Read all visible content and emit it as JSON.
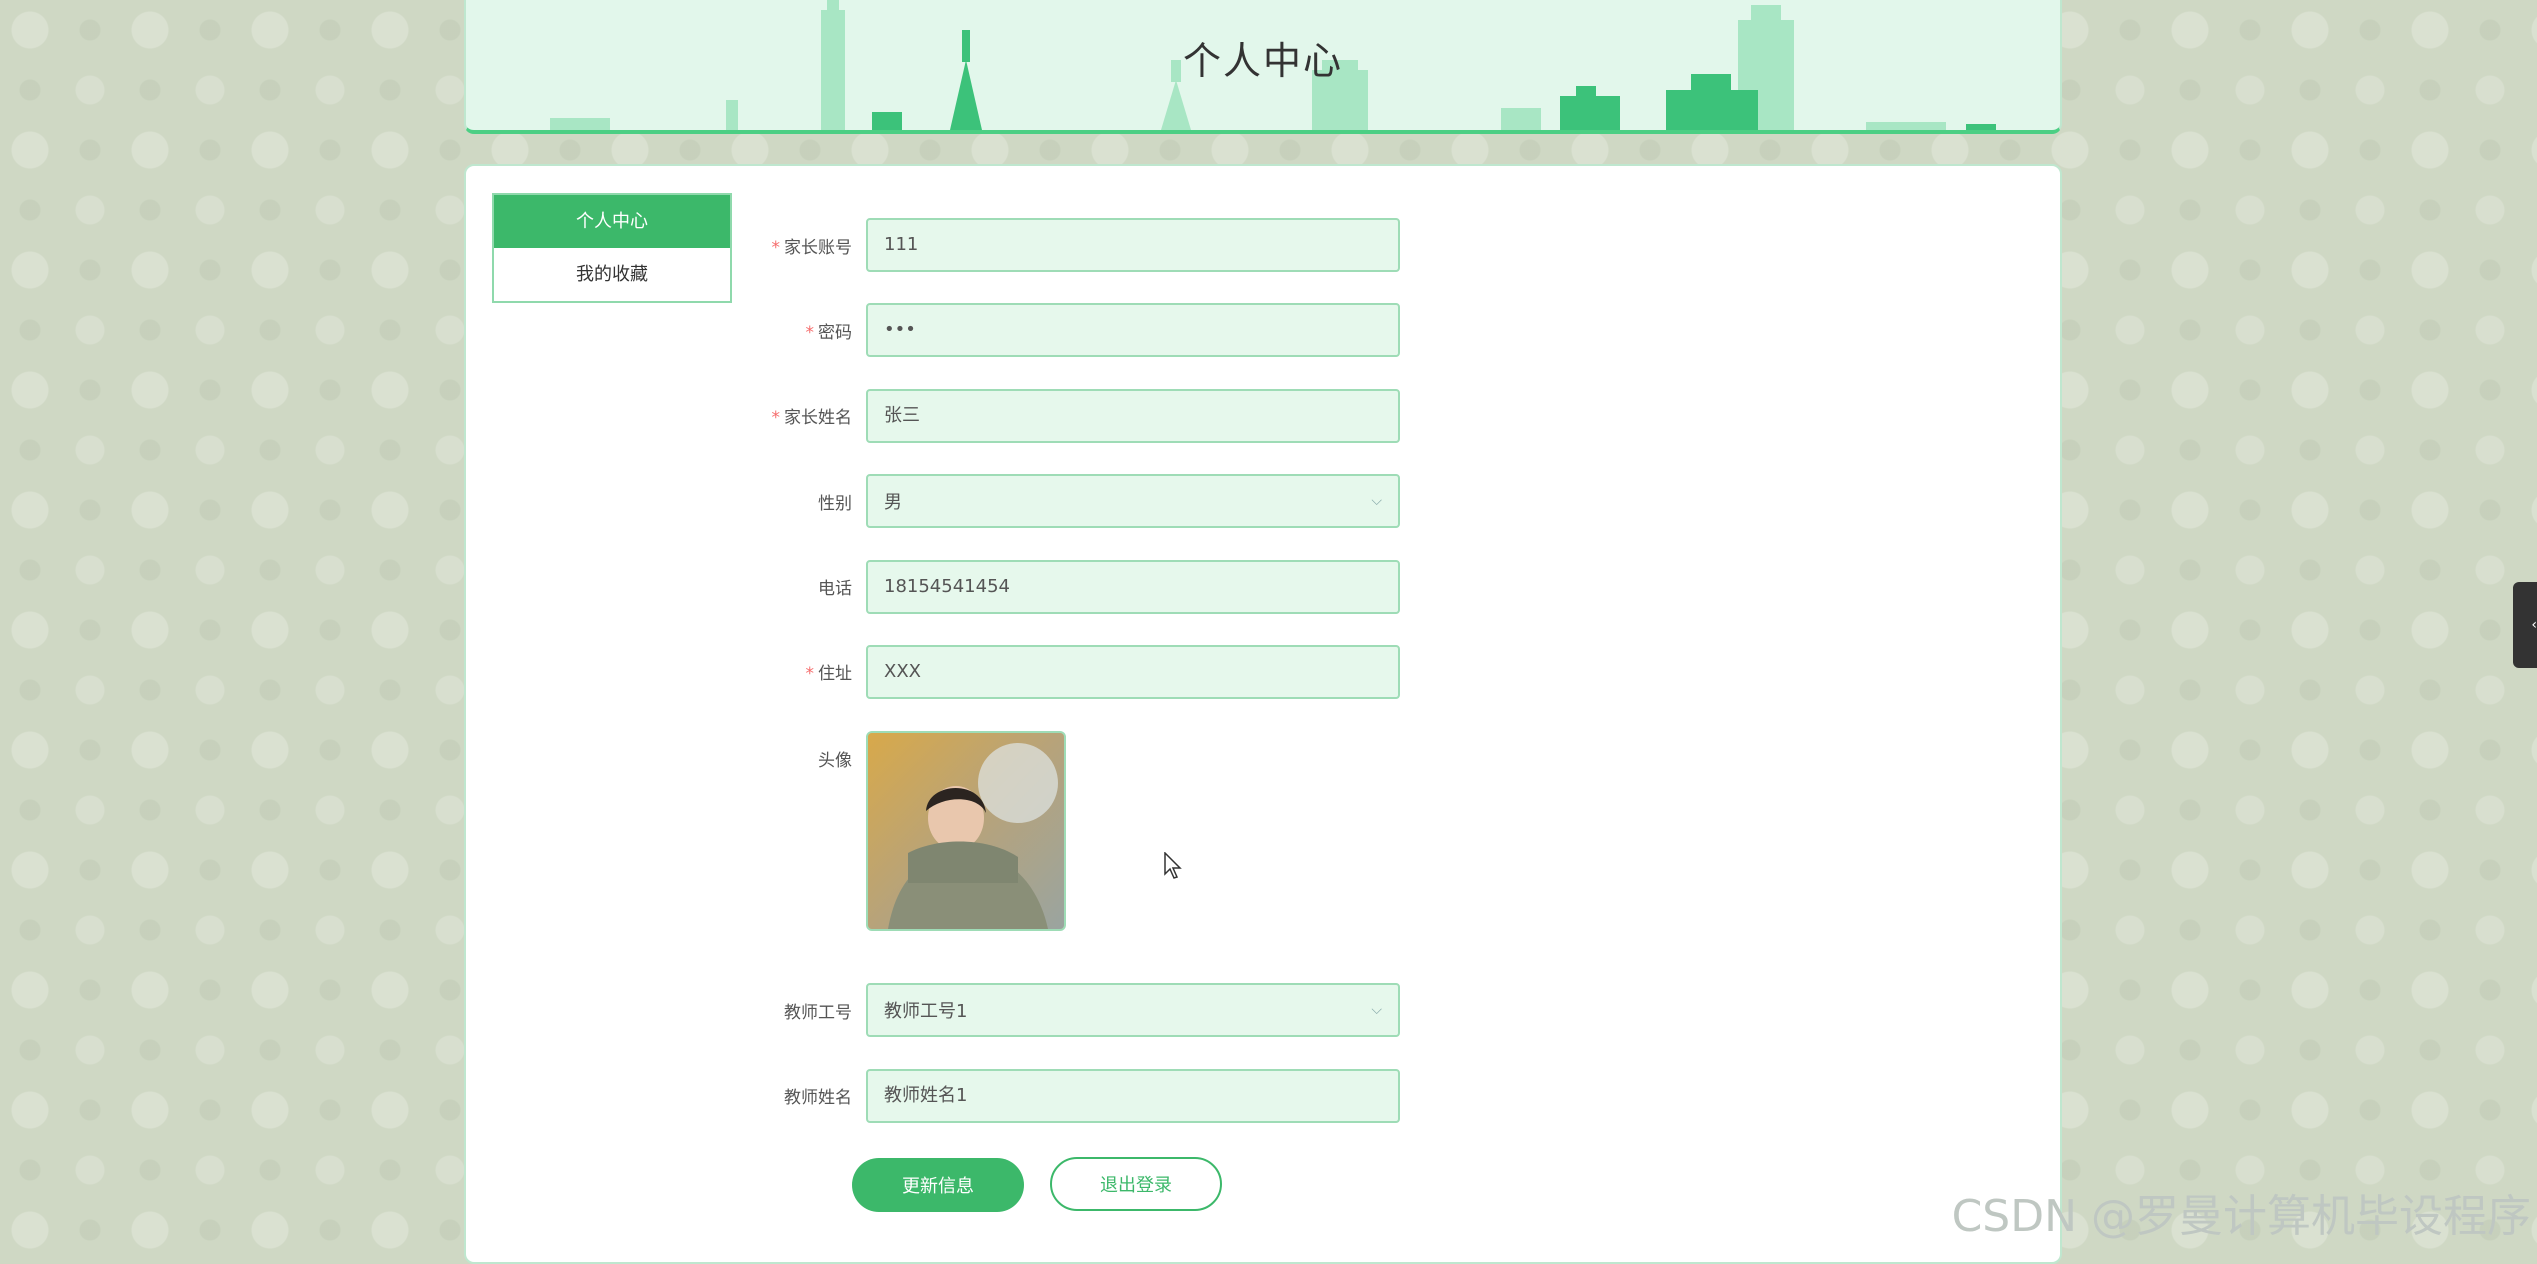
{
  "header": {
    "title": "个人中心"
  },
  "sidebar": {
    "items": [
      {
        "label": "个人中心",
        "active": true
      },
      {
        "label": "我的收藏",
        "active": false
      }
    ]
  },
  "form": {
    "account": {
      "label": "家长账号",
      "required": true,
      "value": "111"
    },
    "password": {
      "label": "密码",
      "required": true,
      "value": "•••"
    },
    "name": {
      "label": "家长姓名",
      "required": true,
      "value": "张三"
    },
    "gender": {
      "label": "性别",
      "required": false,
      "value": "男"
    },
    "phone": {
      "label": "电话",
      "required": false,
      "value": "18154541454"
    },
    "address": {
      "label": "住址",
      "required": true,
      "value": "XXX"
    },
    "avatar": {
      "label": "头像"
    },
    "teacher_id": {
      "label": "教师工号",
      "required": false,
      "value": "教师工号1"
    },
    "teacher_name": {
      "label": "教师姓名",
      "required": false,
      "value": "教师姓名1"
    }
  },
  "buttons": {
    "update": "更新信息",
    "logout": "退出登录"
  },
  "watermark": "CSDN @罗曼计算机毕设程序",
  "colors": {
    "accent": "#3cb86a",
    "field_bg": "#e6f8ec",
    "required": "#f56c6c"
  },
  "icons": {
    "select": "chevron-down-icon",
    "side_tab": "chevron-left-icon"
  }
}
